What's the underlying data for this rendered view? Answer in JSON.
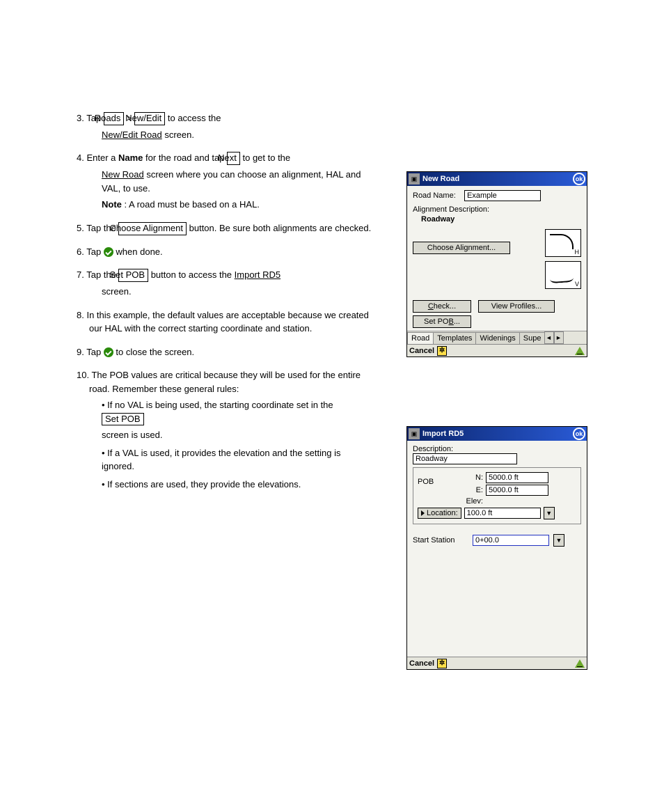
{
  "instructions": {
    "step3_a": "3.  Tap ",
    "step3_roads": "Roads",
    "step3_sep": " > ",
    "step3_newedit": "New/Edit",
    "step3_b": " to access the ",
    "step3_newedit_u": "New/Edit Road",
    "step3_c": " screen.",
    "step4_a": "4.  Enter a ",
    "step4_b": " for the road and tap ",
    "step4_next": "Next",
    "step4_c": " to get to the ",
    "step4_name": "Name",
    "step4_newroad_u": "New Road",
    "step4_d": " screen where you can choose an alignment, HAL and VAL, to use.",
    "step4_note_a": "Note",
    "step4_note_b": ": A road must be based on a HAL.",
    "step5_a": "5.  Tap the ",
    "step5_choose": "Choose Alignment",
    "step5_b": " button.  Be sure both alignments are checked.",
    "step6_a": "6.  Tap ",
    "step6_b": " when done.",
    "step7_a": "7.  Tap the ",
    "step7_setpob": "Set POB",
    "step7_b": " button to access the ",
    "step7_importrd5_u": "Import RD5",
    "step7_c": " screen.",
    "step8_a": "8.  In this example, the default values are acceptable because we created our HAL with the correct starting coordinate and station.",
    "step9_a": "9.  Tap ",
    "step9_b": "  to close the screen.",
    "step10_a": "10.  The POB values are critical because they will be used for the entire road.  Remember these general rules:",
    "bul1_a": "•  If no VAL is being used, the starting coordinate set in the ",
    "bul1_setpob": "Set POB",
    "bul1_b": " screen is used.",
    "bul2_a": "•  If a VAL is used, it provides the elevation and the setting is ignored.",
    "bul3_a": "•  If sections are used, they provide the elevations."
  },
  "win1": {
    "title": "New Road",
    "road_name_lbl": "Road Name:",
    "road_name_val": "Example",
    "align_desc_lbl": "Alignment Description:",
    "align_desc_val": "Roadway",
    "choose_align_btn": "Choose Alignment...",
    "h_label": "H",
    "v_label": "V",
    "check_btn": "Check...",
    "view_profiles_btn": "View Profiles...",
    "setpob_btn": "Set POB...",
    "tab_road": "Road",
    "tab_templates": "Templates",
    "tab_widenings": "Widenings",
    "tab_sup": "Supe",
    "cancel_lbl": "Cancel",
    "ok_lbl": "ok"
  },
  "win2": {
    "title": "Import RD5",
    "desc_lbl": "Description:",
    "desc_val": "Roadway",
    "pob_lbl": "POB",
    "n_lbl": "N:",
    "n_val": "5000.0 ft",
    "e_lbl": "E:",
    "e_val": "5000.0 ft",
    "elev_lbl": "Elev:",
    "location_btn": "Location:",
    "elev_val": "100.0 ft",
    "start_station_lbl": "Start Station",
    "start_station_val": "0+00.0",
    "cancel_lbl": "Cancel",
    "ok_lbl": "ok"
  }
}
